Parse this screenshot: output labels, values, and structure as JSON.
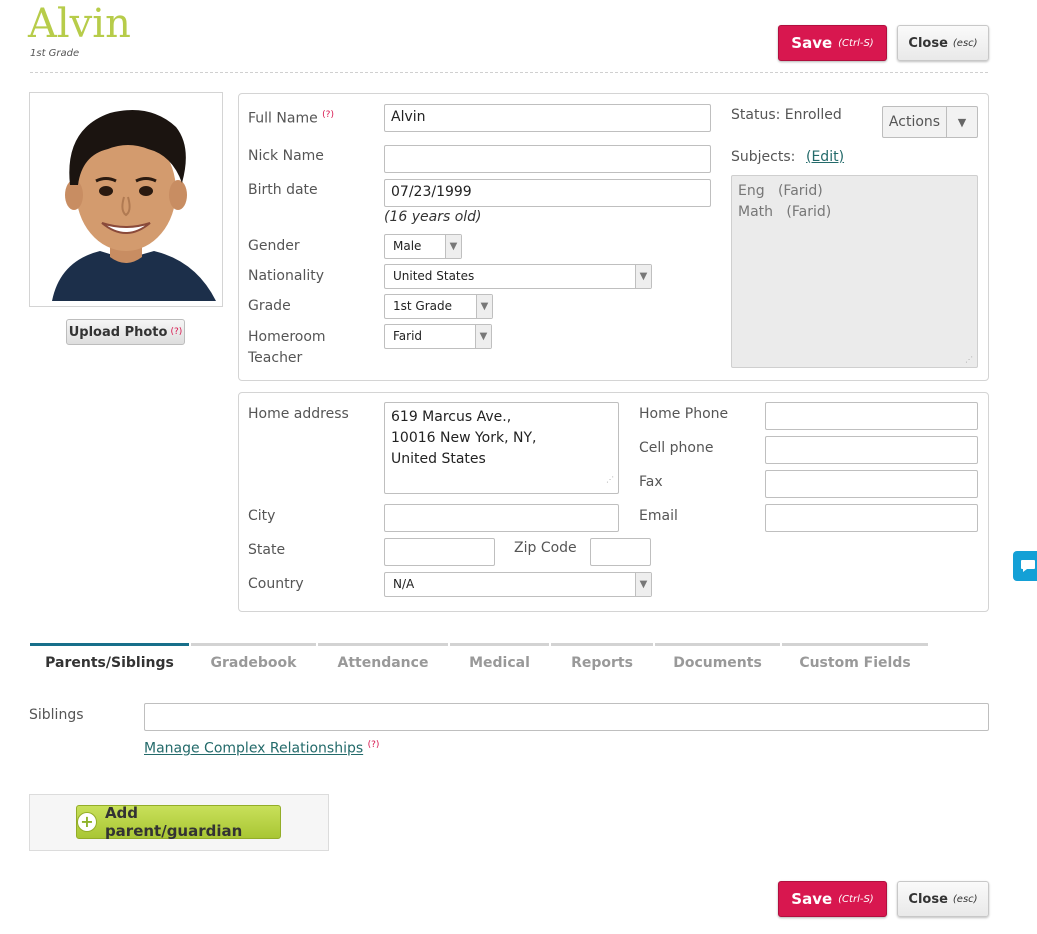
{
  "student": {
    "name": "Alvin",
    "grade_label": "1st Grade"
  },
  "toolbar": {
    "save_label": "Save",
    "save_hint": "(Ctrl-S)",
    "close_label": "Close",
    "close_hint": "(esc)"
  },
  "photo": {
    "upload_label": "Upload Photo",
    "help_marker": "(?)"
  },
  "profile": {
    "full_name_label": "Full Name",
    "full_name_help": "(?)",
    "full_name_value": "Alvin",
    "nick_name_label": "Nick Name",
    "nick_name_value": "",
    "birth_date_label": "Birth date",
    "birth_date_value": "07/23/1999",
    "age_text": "(16 years old)",
    "gender_label": "Gender",
    "gender_value": "Male",
    "nationality_label": "Nationality",
    "nationality_value": "United States",
    "grade_label": "Grade",
    "grade_value": "1st Grade",
    "homeroom_label_line1": "Homeroom",
    "homeroom_label_line2": "Teacher",
    "homeroom_value": "Farid",
    "status_text": "Status: Enrolled",
    "actions_label": "Actions",
    "subjects_label": "Subjects:",
    "subjects_edit": "(Edit)",
    "subjects": [
      {
        "name": "Eng",
        "teacher": "(Farid)"
      },
      {
        "name": "Math",
        "teacher": "(Farid)"
      }
    ]
  },
  "address": {
    "home_address_label": "Home address",
    "home_address_lines": [
      "619 Marcus Ave.,",
      "10016 New York, NY,",
      "United States"
    ],
    "city_label": "City",
    "city_value": "",
    "state_label": "State",
    "state_value": "",
    "zip_label": "Zip Code",
    "zip_value": "",
    "country_label": "Country",
    "country_value": "N/A",
    "home_phone_label": "Home Phone",
    "cell_phone_label": "Cell phone",
    "fax_label": "Fax",
    "email_label": "Email"
  },
  "tabs": [
    {
      "label": "Parents/Siblings",
      "active": true
    },
    {
      "label": "Gradebook",
      "active": false
    },
    {
      "label": "Attendance",
      "active": false
    },
    {
      "label": "Medical",
      "active": false
    },
    {
      "label": "Reports",
      "active": false
    },
    {
      "label": "Documents",
      "active": false
    },
    {
      "label": "Custom Fields",
      "active": false
    }
  ],
  "family": {
    "siblings_label": "Siblings",
    "siblings_value": "",
    "manage_link": "Manage Complex Relationships",
    "manage_help": "(?)",
    "add_parent_label": "Add parent/guardian"
  },
  "colors": {
    "accent_save": "#d8174f",
    "title_green": "#b7cc4a",
    "tab_active": "#176f8a",
    "add_button": "#b5d040",
    "chat_blue": "#14a0d6"
  },
  "icons": {
    "add": "plus-circle-icon",
    "chat": "chat-bubble-icon",
    "dropdown": "chevron-down-icon"
  }
}
